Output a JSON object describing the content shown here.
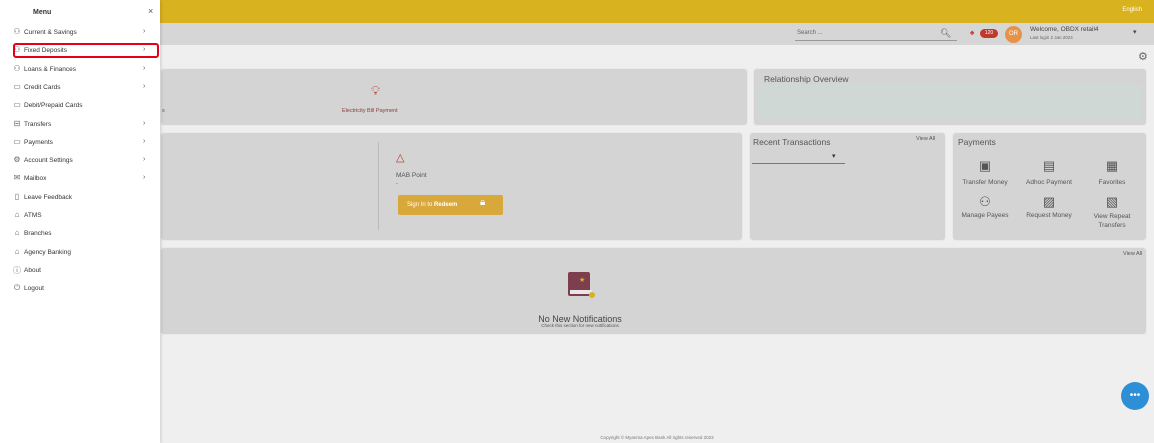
{
  "header": {
    "language": "English",
    "search_placeholder": "Search ...",
    "notifications_count": "120",
    "avatar_initials": "OR",
    "welcome": "Welcome, OBDX retail4",
    "last_login": "Last login 2 Jan 2024"
  },
  "quick_links": {
    "partial_label": "s",
    "electricity_bill": "Electricity Bill Payment"
  },
  "relationship": {
    "title": "Relationship Overview"
  },
  "mab": {
    "label": "MAB Point",
    "value": "-",
    "redeem_prefix": "Sign In to",
    "redeem_bold": "Redeem"
  },
  "recent": {
    "title": "Recent Transactions",
    "view_all": "View All"
  },
  "payments": {
    "title": "Payments",
    "items": [
      {
        "label": "Transfer Money",
        "icon": "transfer-icon"
      },
      {
        "label": "Adhoc Payment",
        "icon": "adhoc-icon"
      },
      {
        "label": "Favorites",
        "icon": "favorites-icon"
      },
      {
        "label": "Manage Payees",
        "icon": "payees-icon"
      },
      {
        "label": "Request Money",
        "icon": "request-icon"
      },
      {
        "label": "View Repeat Transfers",
        "icon": "repeat-icon"
      }
    ]
  },
  "notifications": {
    "view_all": "View All",
    "empty_title": "No New Notifications",
    "empty_sub": "Check this section for new notifications"
  },
  "footer": {
    "copyright": "Copyright © Myanma Apex Bank All rights reserved 2023"
  },
  "sidebar": {
    "title": "Menu",
    "close": "×",
    "items": [
      {
        "label": "Current & Savings",
        "icon": "people-icon",
        "chevron": true
      },
      {
        "label": "Fixed Deposits",
        "icon": "people-icon",
        "chevron": true,
        "highlighted": true
      },
      {
        "label": "Loans & Finances",
        "icon": "people-icon",
        "chevron": true
      },
      {
        "label": "Credit Cards",
        "icon": "card-icon",
        "chevron": true
      },
      {
        "label": "Debit/Prepaid Cards",
        "icon": "card-icon",
        "chevron": false
      },
      {
        "label": "Transfers",
        "icon": "transfer-icon",
        "chevron": true
      },
      {
        "label": "Payments",
        "icon": "card-icon",
        "chevron": true
      },
      {
        "label": "Account Settings",
        "icon": "gear-icon",
        "chevron": true
      },
      {
        "label": "Mailbox",
        "icon": "mail-icon",
        "chevron": true
      },
      {
        "label": "Leave Feedback",
        "icon": "chat-icon",
        "chevron": false
      },
      {
        "label": "ATMS",
        "icon": "bank-icon",
        "chevron": false
      },
      {
        "label": "Branches",
        "icon": "bank-icon",
        "chevron": false
      },
      {
        "label": "Agency Banking",
        "icon": "bank-icon",
        "chevron": false
      },
      {
        "label": "About",
        "icon": "info-icon",
        "chevron": false
      },
      {
        "label": "Logout",
        "icon": "power-icon",
        "chevron": false
      }
    ]
  }
}
